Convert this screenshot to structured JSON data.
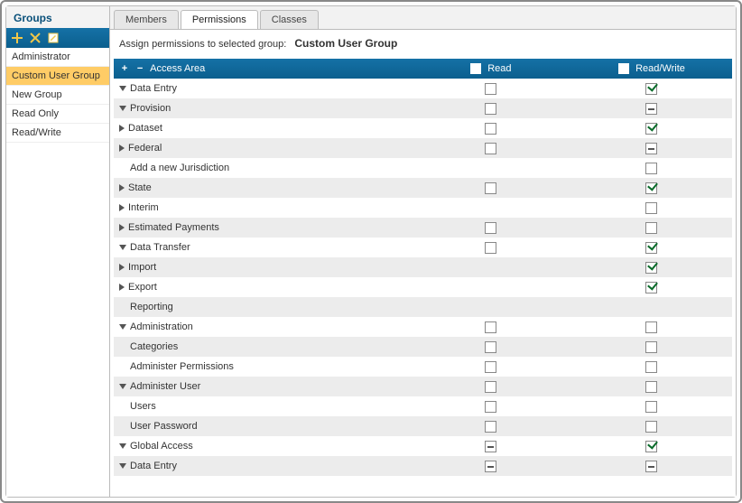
{
  "sidebar": {
    "title": "Groups",
    "toolbar": {
      "add_tip": "Add",
      "delete_tip": "Delete",
      "edit_tip": "Edit"
    },
    "items": [
      {
        "label": "Administrator",
        "selected": false
      },
      {
        "label": "Custom User Group",
        "selected": true
      },
      {
        "label": "New Group",
        "selected": false
      },
      {
        "label": "Read Only",
        "selected": false
      },
      {
        "label": "Read/Write",
        "selected": false
      }
    ]
  },
  "tabs": [
    {
      "label": "Members",
      "active": false
    },
    {
      "label": "Permissions",
      "active": true
    },
    {
      "label": "Classes",
      "active": false
    }
  ],
  "assign": {
    "prefix": "Assign permissions to selected group:",
    "group_name": "Custom User Group"
  },
  "grid": {
    "header": {
      "area": "Access Area",
      "read": "Read",
      "read_write": "Read/Write"
    },
    "rows": [
      {
        "indent": 0,
        "icon": "open",
        "label": "Data Entry",
        "read": "empty",
        "rw": "checked",
        "zebra": "even"
      },
      {
        "indent": 1,
        "icon": "open",
        "label": "Provision",
        "read": "empty",
        "rw": "indet",
        "zebra": "odd"
      },
      {
        "indent": 2,
        "icon": "closed",
        "label": "Dataset",
        "read": "empty",
        "rw": "checked",
        "zebra": "even"
      },
      {
        "indent": 2,
        "icon": "closed",
        "label": "Federal",
        "read": "empty",
        "rw": "indet",
        "zebra": "odd"
      },
      {
        "indent": 2,
        "icon": "none",
        "label": "Add a new Jurisdiction",
        "read": "none",
        "rw": "empty",
        "zebra": "even"
      },
      {
        "indent": 2,
        "icon": "closed",
        "label": "State",
        "read": "empty",
        "rw": "checked",
        "zebra": "odd"
      },
      {
        "indent": 1,
        "icon": "closed",
        "label": "Interim",
        "read": "none",
        "rw": "empty",
        "zebra": "even"
      },
      {
        "indent": 1,
        "icon": "closed",
        "label": "Estimated Payments",
        "read": "empty",
        "rw": "empty",
        "zebra": "odd"
      },
      {
        "indent": 0,
        "icon": "open",
        "label": "Data Transfer",
        "read": "empty",
        "rw": "checked",
        "zebra": "even"
      },
      {
        "indent": 1,
        "icon": "closed",
        "label": "Import",
        "read": "none",
        "rw": "checked",
        "zebra": "odd"
      },
      {
        "indent": 1,
        "icon": "closed",
        "label": "Export",
        "read": "none",
        "rw": "checked",
        "zebra": "even"
      },
      {
        "indent": 0,
        "icon": "none",
        "label": "Reporting",
        "read": "none",
        "rw": "none",
        "zebra": "odd"
      },
      {
        "indent": 0,
        "icon": "open",
        "label": "Administration",
        "read": "empty",
        "rw": "empty",
        "zebra": "even"
      },
      {
        "indent": 1,
        "icon": "none",
        "label": "Categories",
        "read": "empty",
        "rw": "empty",
        "zebra": "odd"
      },
      {
        "indent": 1,
        "icon": "none",
        "label": "Administer Permissions",
        "read": "empty",
        "rw": "empty",
        "zebra": "even"
      },
      {
        "indent": 1,
        "icon": "open",
        "label": "Administer User",
        "read": "empty",
        "rw": "empty",
        "zebra": "odd"
      },
      {
        "indent": 2,
        "icon": "none",
        "label": "Users",
        "read": "empty",
        "rw": "empty",
        "zebra": "even"
      },
      {
        "indent": 2,
        "icon": "none",
        "label": "User Password",
        "read": "empty",
        "rw": "empty",
        "zebra": "odd"
      },
      {
        "indent": 0,
        "icon": "open",
        "label": "Global Access",
        "read": "indet",
        "rw": "checked",
        "zebra": "even"
      },
      {
        "indent": 1,
        "icon": "open",
        "label": "Data Entry",
        "read": "indet",
        "rw": "indet",
        "zebra": "odd"
      }
    ]
  }
}
